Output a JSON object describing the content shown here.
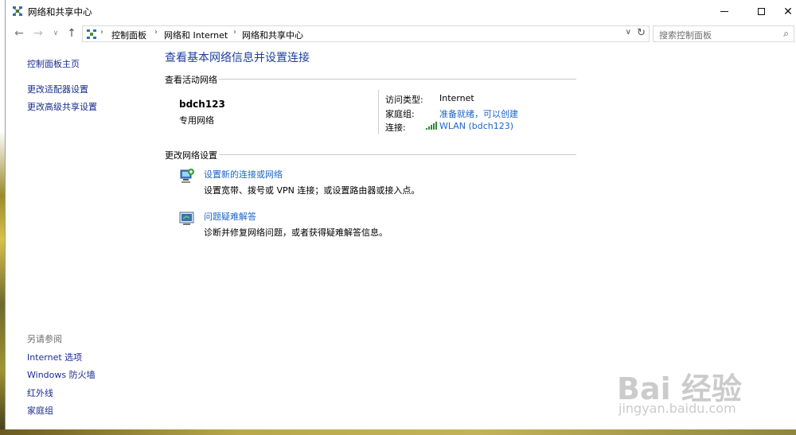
{
  "window": {
    "title": "网络和共享中心",
    "icon": "network-center-icon"
  },
  "address": {
    "crumbs": [
      "控制面板",
      "网络和 Internet",
      "网络和共享中心"
    ]
  },
  "search": {
    "placeholder": "搜索控制面板"
  },
  "sidebar": {
    "home": "控制面板主页",
    "links": [
      "更改适配器设置",
      "更改高级共享设置"
    ],
    "see_also_heading": "另请参阅",
    "see_also": [
      "Internet 选项",
      "Windows 防火墙",
      "红外线",
      "家庭组"
    ]
  },
  "main": {
    "title": "查看基本网络信息并设置连接",
    "active_heading": "查看活动网络",
    "network": {
      "name": "bdch123",
      "type": "专用网络",
      "access_type_label": "访问类型:",
      "access_type_value": "Internet",
      "homegroup_label": "家庭组:",
      "homegroup_value": "准备就绪，可以创建",
      "connection_label": "连接:",
      "connection_value": "WLAN (bdch123)"
    },
    "change_heading": "更改网络设置",
    "tasks": [
      {
        "title": "设置新的连接或网络",
        "desc": "设置宽带、拨号或 VPN 连接；或设置路由器或接入点。"
      },
      {
        "title": "问题疑难解答",
        "desc": "诊断并修复网络问题，或者获得疑难解答信息。"
      }
    ]
  },
  "watermark": {
    "brand": "Bai  经验",
    "url": "jingyan.baidu.com"
  },
  "colors": {
    "link": "#1c66c6",
    "title": "#1e3f9d",
    "sidebar_link": "#1a2c8c"
  }
}
